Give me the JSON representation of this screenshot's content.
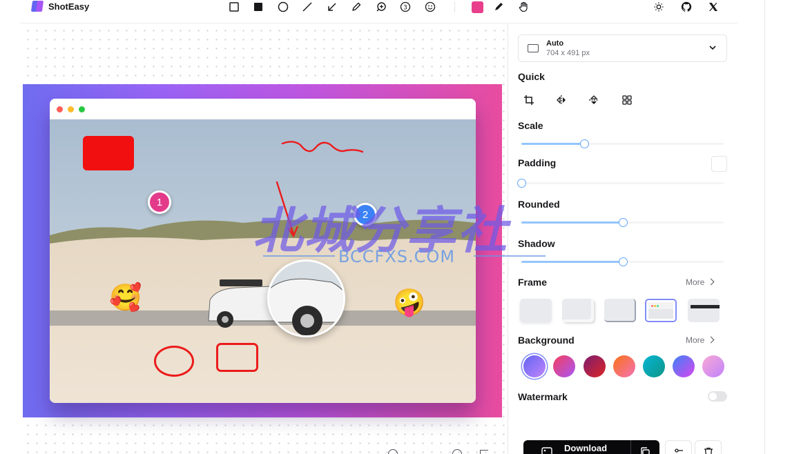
{
  "app": {
    "name": "ShotEasy"
  },
  "toolbar": {
    "tools": [
      "rectangle-outline",
      "rectangle-filled",
      "circle",
      "line",
      "arrow",
      "pen",
      "magnifier",
      "number",
      "emoji"
    ],
    "active_color": "#e83e8c"
  },
  "canvas": {
    "badges": [
      "1",
      "2"
    ],
    "emojis": [
      "🥰",
      "🤪"
    ]
  },
  "watermark": {
    "cn": "北城分享社",
    "en": "BCCFXS.COM"
  },
  "panel": {
    "size": {
      "name": "Auto",
      "dimensions": "704 x 491 px"
    },
    "quick_label": "Quick",
    "scale_label": "Scale",
    "padding_label": "Padding",
    "rounded_label": "Rounded",
    "shadow_label": "Shadow",
    "frame_label": "Frame",
    "frame_more": "More",
    "background_label": "Background",
    "background_more": "More",
    "watermark_label": "Watermark",
    "download_label": "Download",
    "slider_levels": {
      "scale": 0.31,
      "padding": 0.0,
      "rounded": 0.5,
      "shadow": 0.5
    },
    "watermark_enabled": false,
    "selected_frame": 3,
    "selected_background": 0
  }
}
